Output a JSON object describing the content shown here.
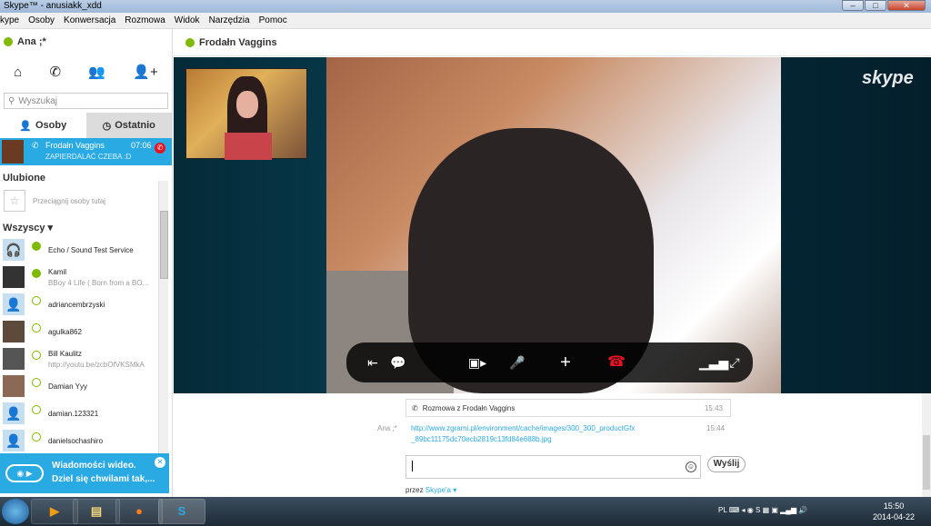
{
  "window": {
    "title": "Skype™ - anusiakk_xdd"
  },
  "menu": [
    "kype",
    "Osoby",
    "Konwersacja",
    "Rozmowa",
    "Widok",
    "Narzędzia",
    "Pomoc"
  ],
  "user": {
    "name": "Ana ;*"
  },
  "search": {
    "placeholder": "Wyszukaj"
  },
  "tabs": {
    "people": "Osoby",
    "recent": "Ostatnio"
  },
  "active_call": {
    "name": "Frodałn Vaggins",
    "time": "07:06",
    "mood": "ZAPIERDALAĆ CZEBA :D"
  },
  "favorites": {
    "title": "Ulubione",
    "hint": "Przeciągnij osoby tutaj"
  },
  "all": {
    "title": "Wszyscy"
  },
  "contacts": [
    {
      "name": "Echo / Sound Test Service",
      "mood": ""
    },
    {
      "name": "Kamil",
      "mood": "BBoy 4 Life ( Born from a BO..."
    },
    {
      "name": "adriancembrzyski",
      "mood": ""
    },
    {
      "name": "agulka862",
      "mood": ""
    },
    {
      "name": "Bill Kaulitz",
      "mood": "http://youtu.be/zcbOfVKSMkA"
    },
    {
      "name": "Damian Yyy",
      "mood": ""
    },
    {
      "name": "damian.123321",
      "mood": ""
    },
    {
      "name": "danielsochashiro",
      "mood": ""
    }
  ],
  "promo": {
    "line1": "Wiadomości wideo.",
    "line2": "Dziel się chwilami tak,..."
  },
  "conversation": {
    "title": "Frodałn Vaggins"
  },
  "video": {
    "logo": "skype"
  },
  "chat": {
    "call_note": "Rozmowa z Frodałn Vaggins",
    "call_time": "15:43",
    "author": "Ana ;*",
    "link_line1": "http://www.zgrami.pl/environment/cache/images/300_300_productGfx",
    "link_line2": "_89bc11175dc70ecb2819c13fd84e688b.jpg",
    "msg_time": "15:44",
    "send": "Wyślij",
    "via_prefix": "przez",
    "via_link": "Skype'a"
  },
  "taskbar": {
    "lang": "PL",
    "time": "15:50",
    "date": "2014-04-22"
  },
  "colors": {
    "accent": "#2aaae2",
    "online": "#7fba00",
    "hangup": "#e81123"
  }
}
